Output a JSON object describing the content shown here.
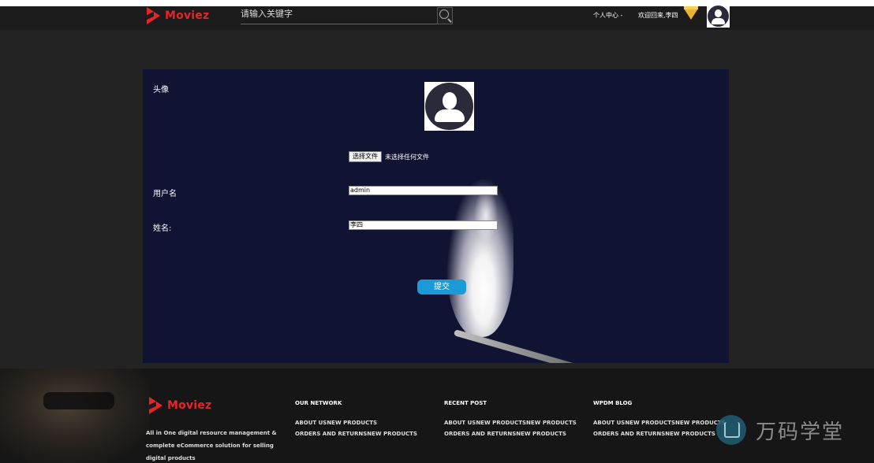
{
  "header": {
    "logo_text": "Moviez",
    "search_placeholder": "请输入关键字",
    "user_center": "个人中心 -",
    "welcome": "欢迎回来,李四"
  },
  "form": {
    "avatar_label": "头像",
    "file_button": "选择文件",
    "file_status": "未选择任何文件",
    "username_label": "用户名",
    "username_value": "admin",
    "name_label": "姓名:",
    "name_value": "李四",
    "submit_label": "提交"
  },
  "footer": {
    "logo_text": "Moviez",
    "description": "All in One digital resource management & complete eCommerce solution for selling digital products",
    "columns": [
      {
        "title": "OUR NETWORK",
        "links": [
          "ABOUT USNEW PRODUCTS",
          "ORDERS AND RETURNSNEW PRODUCTS"
        ]
      },
      {
        "title": "RECENT POST",
        "links": [
          "ABOUT USNEW PRODUCTSNEW PRODUCTS",
          "ORDERS AND RETURNSNEW PRODUCTS"
        ]
      },
      {
        "title": "WPDM BLOG",
        "links": [
          "ABOUT USNEW PRODUCTSNEW PRODUCTS",
          "ORDERS AND RETURNSNEW PRODUCTS"
        ]
      }
    ]
  },
  "watermark": "万码学堂",
  "colors": {
    "brand": "#e8232b",
    "accent": "#1a9ad6",
    "panel": "#101332"
  }
}
